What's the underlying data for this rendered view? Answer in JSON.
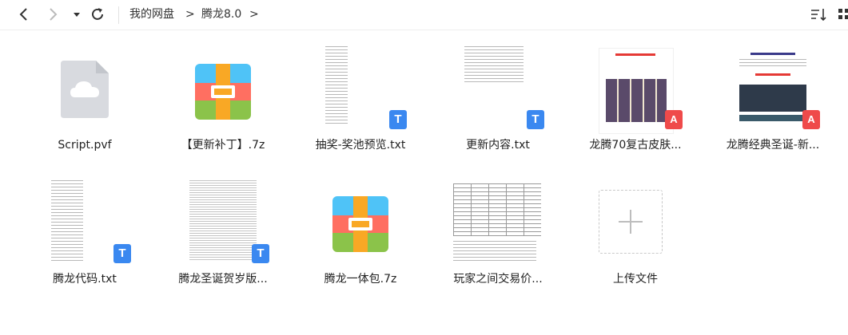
{
  "toolbar": {
    "back_icon": "chevron-left-icon",
    "forward_icon": "chevron-right-icon",
    "history_icon": "caret-down-icon",
    "refresh_icon": "refresh-icon",
    "sort_icon": "sort-icon",
    "more_icon": "grid-icon",
    "breadcrumb": [
      {
        "label": "我的网盘"
      },
      {
        "label": "腾龙8.0"
      }
    ],
    "separator": ">"
  },
  "files": [
    {
      "name": "Script.pvf",
      "kind": "cloud"
    },
    {
      "name": "【更新补丁】.7z",
      "kind": "archive"
    },
    {
      "name": "抽奖-奖池预览.txt",
      "kind": "txt"
    },
    {
      "name": "更新内容.txt",
      "kind": "txt"
    },
    {
      "name": "龙腾70复古皮肤...",
      "kind": "pdf"
    },
    {
      "name": "龙腾经典圣诞-新...",
      "kind": "pdf"
    },
    {
      "name": "腾龙代码.txt",
      "kind": "txt"
    },
    {
      "name": "腾龙圣诞贺岁版...",
      "kind": "txt"
    },
    {
      "name": "腾龙一体包.7z",
      "kind": "archive"
    },
    {
      "name": "玩家之间交易价...",
      "kind": "doc"
    }
  ],
  "upload": {
    "label": "上传文件",
    "icon": "plus-icon"
  },
  "badges": {
    "txt": "T",
    "pdf": "A"
  },
  "colors": {
    "txt_badge": "#3a88f0",
    "pdf_badge": "#ef4a4a",
    "cloud_bg": "#d8dadf"
  }
}
